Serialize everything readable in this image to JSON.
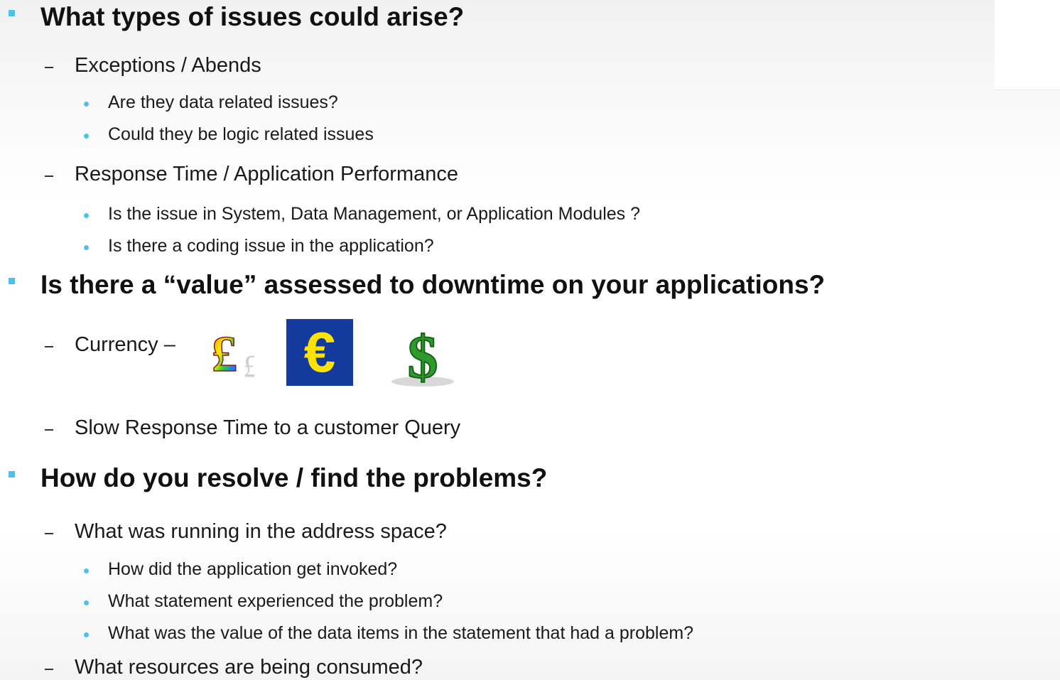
{
  "slide": {
    "sections": [
      {
        "heading": "What types of issues could arise?",
        "items": [
          {
            "text": "Exceptions / Abends",
            "subitems": [
              "Are they data related issues?",
              "Could they be logic related issues"
            ]
          },
          {
            "text": "Response Time / Application Performance",
            "subitems": [
              "Is the issue in System, Data Management, or Application Modules ?",
              "Is there a coding issue in the application?"
            ]
          }
        ]
      },
      {
        "heading": "Is there a “value” assessed to downtime on your applications?",
        "items": [
          {
            "text": "Currency –"
          },
          {
            "text": "Slow Response Time to a customer Query"
          }
        ]
      },
      {
        "heading": "How do you resolve / find the problems?",
        "items": [
          {
            "text": "What was running in the address space?",
            "subitems": [
              "How did the application get invoked?",
              "What statement experienced the problem?",
              "What was the value of the data items in the statement that had a problem?"
            ]
          },
          {
            "text": "What resources are being consumed?"
          }
        ]
      }
    ]
  },
  "currency_icons": [
    {
      "name": "pound-icon",
      "symbol": "£"
    },
    {
      "name": "euro-icon",
      "symbol": "€"
    },
    {
      "name": "dollar-icon",
      "symbol": "$"
    }
  ],
  "colors": {
    "bullet": "#50c0e8",
    "euro_bg": "#143a9e",
    "euro_fg": "#ffe400",
    "dollar": "#2e9a2e"
  }
}
